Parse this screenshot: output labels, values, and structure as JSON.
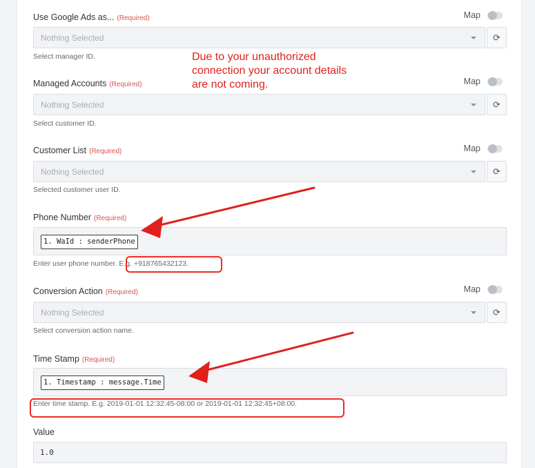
{
  "fields": {
    "google_ads": {
      "label": "Use Google Ads as...",
      "required": "(Required)",
      "map_label": "Map",
      "placeholder": "Nothing Selected",
      "help": "Select manager ID."
    },
    "managed_accounts": {
      "label": "Managed Accounts",
      "required": "(Required)",
      "map_label": "Map",
      "placeholder": "Nothing Selected",
      "help": "Select customer ID."
    },
    "customer_list": {
      "label": "Customer List",
      "required": "(Required)",
      "map_label": "Map",
      "placeholder": "Nothing Selected",
      "help": "Selected customer user ID."
    },
    "phone_number": {
      "label": "Phone Number",
      "required": "(Required)",
      "chip": "1. WaId : senderPhone",
      "help_prefix": "Enter user phone number.",
      "help_example": "E.g. +918765432123."
    },
    "conversion_action": {
      "label": "Conversion Action",
      "required": "(Required)",
      "map_label": "Map",
      "placeholder": "Nothing Selected",
      "help": "Select conversion action name."
    },
    "time_stamp": {
      "label": "Time Stamp",
      "required": "(Required)",
      "chip": "1. Timestamp : message.Time",
      "help": "Enter time stamp. E.g. 2019-01-01 12:32:45-08:00 or 2019-01-01 12:32:45+08:00."
    },
    "value": {
      "label": "Value",
      "value": "1.0"
    }
  },
  "annotation": {
    "note": "Due to your unauthorized connection your account details are not coming.",
    "color": "#e0201b"
  },
  "icons": {
    "refresh": "refresh-icon",
    "caret": "chevron-down-icon"
  }
}
